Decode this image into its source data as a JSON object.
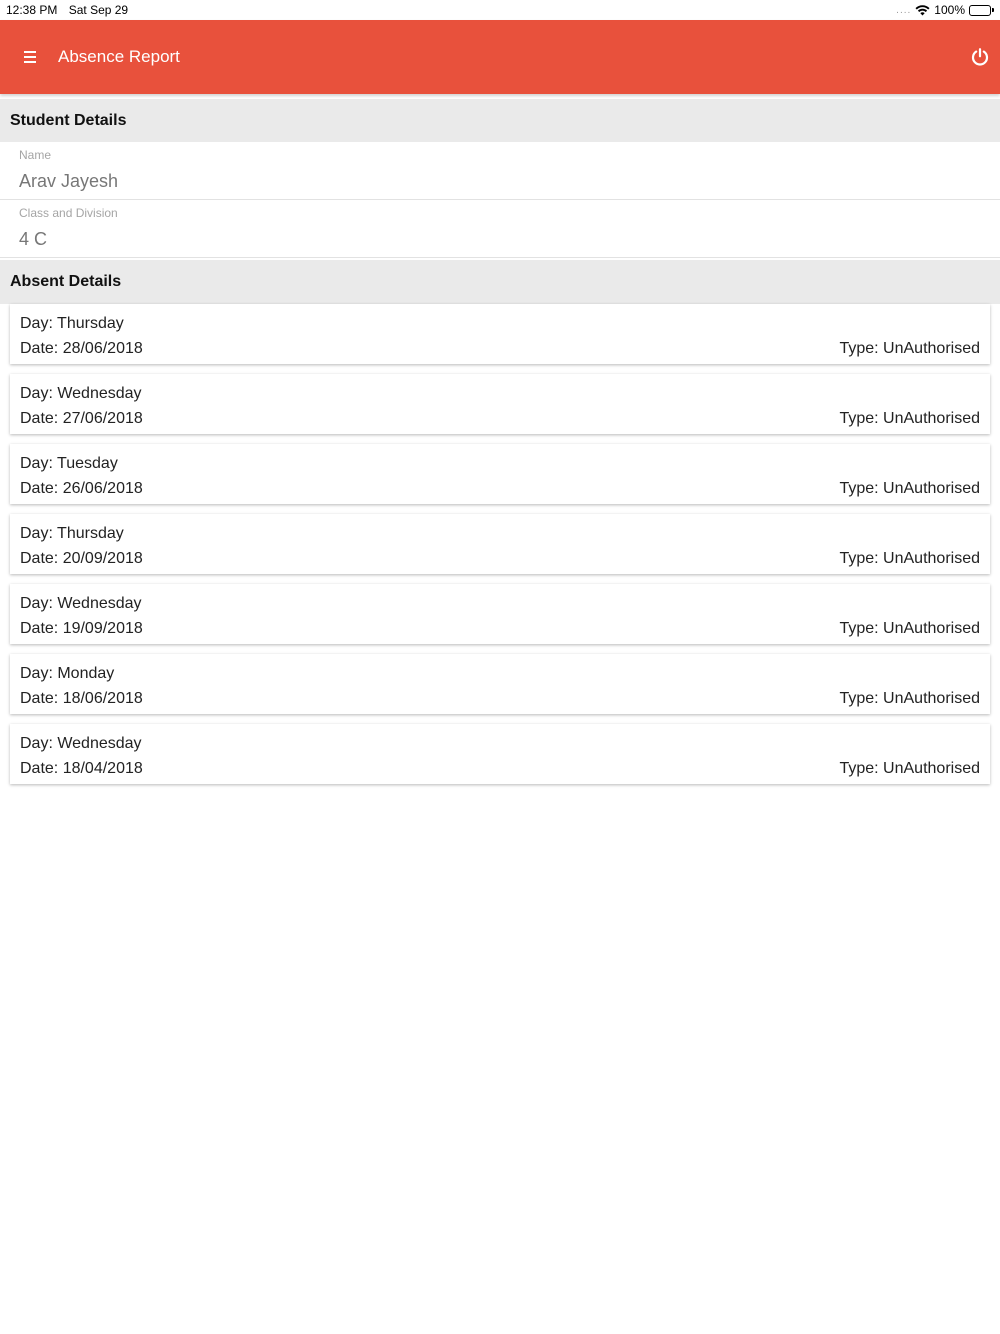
{
  "status_bar": {
    "time": "12:38 PM",
    "date": "Sat Sep 29",
    "signal": "....",
    "battery": "100%"
  },
  "app_bar": {
    "title": "Absence Report",
    "menu_icon": "hamburger-menu-icon",
    "power_icon": "power-icon",
    "color": "#e8513c"
  },
  "student_details": {
    "header": "Student Details",
    "name_label": "Name",
    "name_value": "Arav Jayesh",
    "class_label": "Class and Division",
    "class_value": "4 C"
  },
  "absent_details": {
    "header": "Absent Details",
    "records": [
      {
        "day": "Day: Thursday",
        "date": "Date: 28/06/2018",
        "type": "Type: UnAuthorised"
      },
      {
        "day": "Day: Wednesday",
        "date": "Date: 27/06/2018",
        "type": "Type: UnAuthorised"
      },
      {
        "day": "Day: Tuesday",
        "date": "Date: 26/06/2018",
        "type": "Type: UnAuthorised"
      },
      {
        "day": "Day: Thursday",
        "date": "Date: 20/09/2018",
        "type": "Type: UnAuthorised"
      },
      {
        "day": "Day: Wednesday",
        "date": "Date: 19/09/2018",
        "type": "Type: UnAuthorised"
      },
      {
        "day": "Day: Monday",
        "date": "Date: 18/06/2018",
        "type": "Type: UnAuthorised"
      },
      {
        "day": "Day: Wednesday",
        "date": "Date: 18/04/2018",
        "type": "Type: UnAuthorised"
      }
    ]
  }
}
